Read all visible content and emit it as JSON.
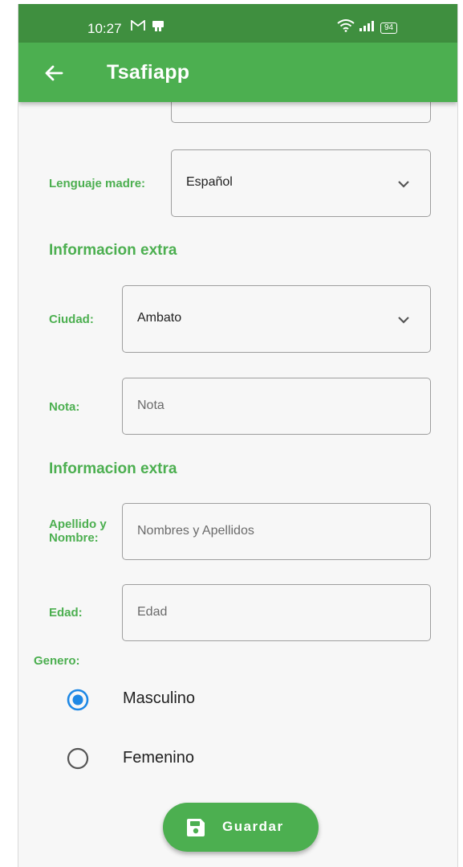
{
  "status_bar": {
    "time": "10:27",
    "battery": "94"
  },
  "app_bar": {
    "title": "Tsafiapp"
  },
  "form": {
    "mother_tongue": {
      "label": "Lenguaje madre:",
      "value": "Español"
    },
    "section_extra_1": "Informacion extra",
    "city": {
      "label": "Ciudad:",
      "value": "Ambato"
    },
    "note": {
      "label": "Nota:",
      "placeholder": "Nota"
    },
    "section_extra_2": "Informacion extra",
    "name": {
      "label_line1": "Apellido y",
      "label_line2": "Nombre:",
      "placeholder": "Nombres y Apellidos"
    },
    "age": {
      "label": "Edad:",
      "placeholder": "Edad"
    },
    "gender": {
      "label": "Genero:",
      "options": [
        {
          "label": "Masculino",
          "selected": true
        },
        {
          "label": "Femenino",
          "selected": false
        }
      ]
    },
    "save_label": "Guardar"
  },
  "colors": {
    "primary": "#4caf50",
    "status_bar": "#3f8f3f",
    "radio_selected": "#1e88e5"
  }
}
